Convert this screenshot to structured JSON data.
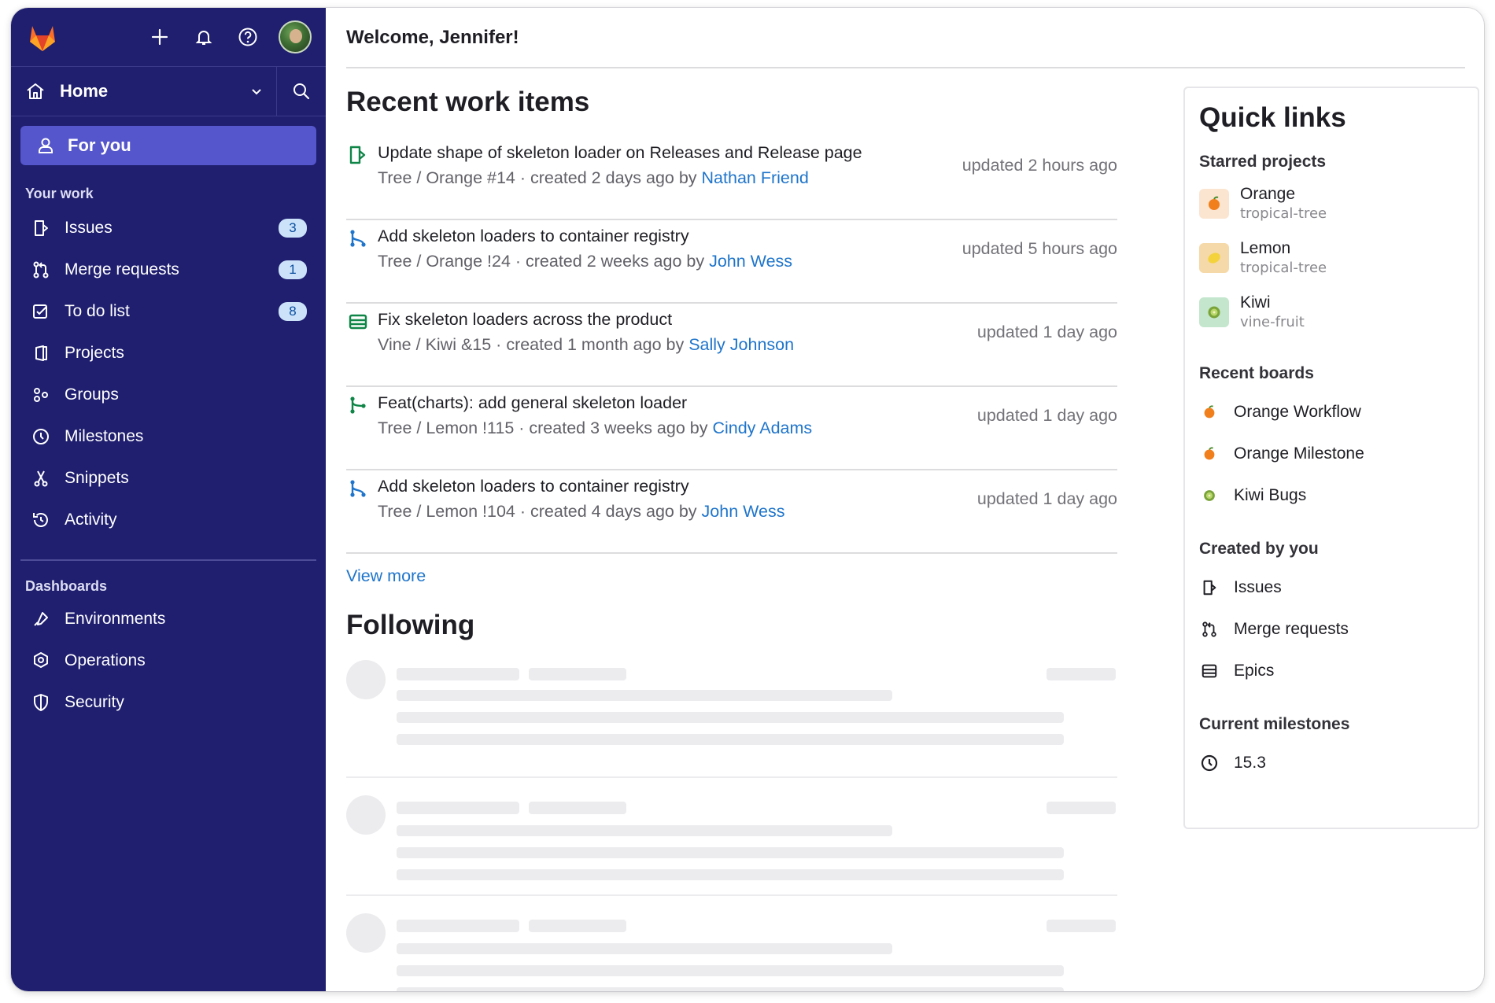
{
  "sidebar": {
    "context": "Home",
    "for_you": "For you",
    "your_work_heading": "Your work",
    "items": [
      {
        "label": "Issues",
        "count": "3",
        "icon": "issues-icon"
      },
      {
        "label": "Merge requests",
        "count": "1",
        "icon": "merge-request-icon"
      },
      {
        "label": "To do list",
        "count": "8",
        "icon": "todo-icon"
      },
      {
        "label": "Projects",
        "icon": "project-icon"
      },
      {
        "label": "Groups",
        "icon": "groups-icon"
      },
      {
        "label": "Milestones",
        "icon": "clock-icon"
      },
      {
        "label": "Snippets",
        "icon": "snippet-icon"
      },
      {
        "label": "Activity",
        "icon": "history-icon"
      }
    ],
    "dashboards_heading": "Dashboards",
    "dashboards": [
      {
        "label": "Environments",
        "icon": "environment-icon"
      },
      {
        "label": "Operations",
        "icon": "operations-icon"
      },
      {
        "label": "Security",
        "icon": "shield-icon"
      }
    ]
  },
  "header": {
    "welcome": "Welcome, Jennifer!"
  },
  "recent": {
    "title": "Recent work items",
    "items": [
      {
        "title": "Update shape of skeleton loader on Releases and Release page",
        "path": "Tree / Orange #14 · created 2 days ago by ",
        "author": "Nathan Friend",
        "updated": "updated 2 hours ago",
        "type": "issue"
      },
      {
        "title": "Add skeleton loaders to container registry",
        "path": "Tree / Orange !24 · created 2 weeks ago by ",
        "author": "John Wess",
        "updated": "updated 5 hours ago",
        "type": "merge-request"
      },
      {
        "title": "Fix skeleton loaders across the product",
        "path": "Vine / Kiwi &15 · created 1 month ago by ",
        "author": "Sally Johnson",
        "updated": "updated 1 day ago",
        "type": "epic"
      },
      {
        "title": "Feat(charts): add general skeleton loader",
        "path": "Tree / Lemon !115 · created 3 weeks ago by ",
        "author": "Cindy Adams",
        "updated": "updated 1 day ago",
        "type": "merge-request-merged"
      },
      {
        "title": "Add skeleton loaders to container registry",
        "path": "Tree / Lemon !104 · created 4 days ago by ",
        "author": "John Wess",
        "updated": "updated 1 day ago",
        "type": "merge-request"
      }
    ],
    "view_more": "View more"
  },
  "following": {
    "title": "Following"
  },
  "quick_links": {
    "title": "Quick links",
    "starred_heading": "Starred projects",
    "starred": [
      {
        "name": "Orange",
        "path": "tropical-tree",
        "bg": "#fbe5d1"
      },
      {
        "name": "Lemon",
        "path": "tropical-tree",
        "bg": "#f5d9a8"
      },
      {
        "name": "Kiwi",
        "path": "vine-fruit",
        "bg": "#c3e6cd"
      }
    ],
    "boards_heading": "Recent boards",
    "boards": [
      "Orange Workflow",
      "Orange Milestone",
      "Kiwi Bugs"
    ],
    "created_heading": "Created by you",
    "created": [
      "Issues",
      "Merge requests",
      "Epics"
    ],
    "milestones_heading": "Current milestones",
    "milestones": [
      "15.3"
    ]
  },
  "colors": {
    "sidebar": "#1f1e6f",
    "active": "#5555cc",
    "link": "#1f75cb",
    "badge": "#cbe2f9"
  }
}
